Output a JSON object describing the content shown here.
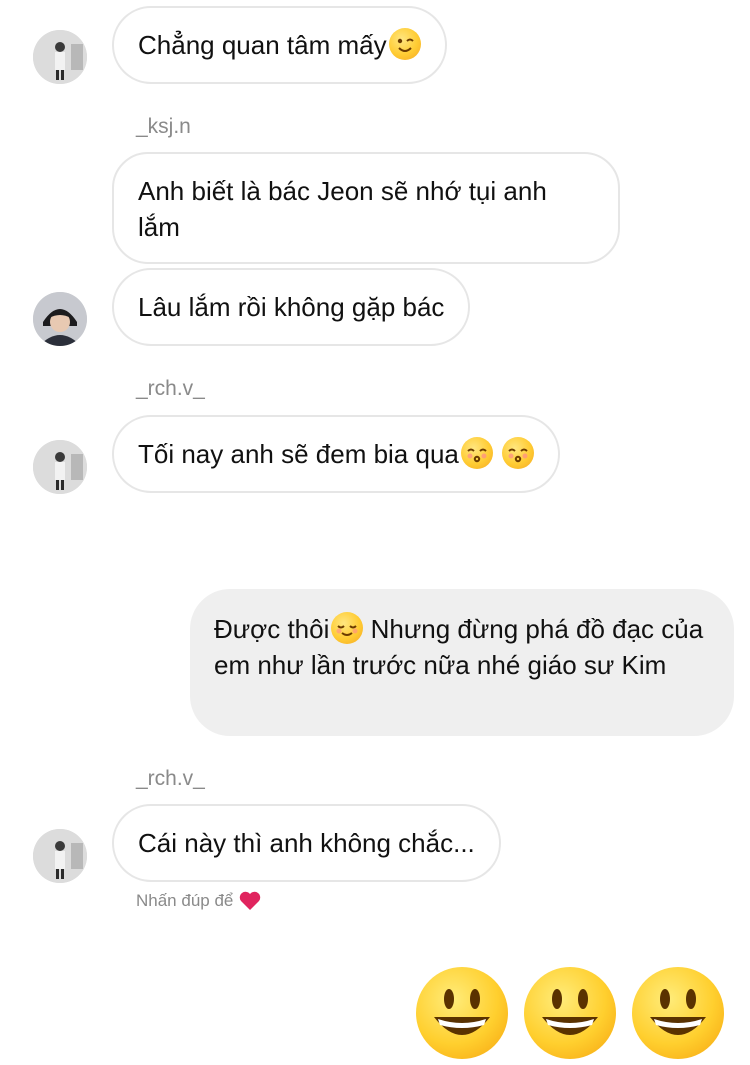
{
  "messages": [
    {
      "type": "incoming",
      "text": "Chẳng quan tâm mấy",
      "emoji": [
        "wink-face"
      ]
    },
    {
      "type": "sender",
      "name": "_ksj.n"
    },
    {
      "type": "incoming",
      "text": "Anh biết là bác Jeon sẽ nhớ tụi anh lắm"
    },
    {
      "type": "incoming",
      "text": "Lâu lắm rồi không gặp bác"
    },
    {
      "type": "sender",
      "name": "_rch.v_"
    },
    {
      "type": "incoming",
      "text": "Tối nay anh sẽ đem bia qua",
      "emoji": [
        "kissing-face",
        "kissing-face"
      ]
    },
    {
      "type": "outgoing",
      "text_before_emoji": "Được thôi",
      "emoji": [
        "relieved-face"
      ],
      "text_after_emoji": " Nhưng đừng phá đồ đạc của em như lần trước nữa nhé giáo sư Kim"
    },
    {
      "type": "sender",
      "name": "_rch.v_"
    },
    {
      "type": "incoming",
      "text": "Cái này thì anh không chắc..."
    }
  ],
  "hint": {
    "text": "Nhấn đúp để",
    "icon": "red-heart-icon"
  },
  "big_emojis": [
    "grinning-face",
    "grinning-face",
    "grinning-face"
  ],
  "colors": {
    "incoming_border": "#e6e6e6",
    "outgoing_bg": "#efefef",
    "meta_text": "#8a8a8a",
    "heart": "#e0245e"
  }
}
